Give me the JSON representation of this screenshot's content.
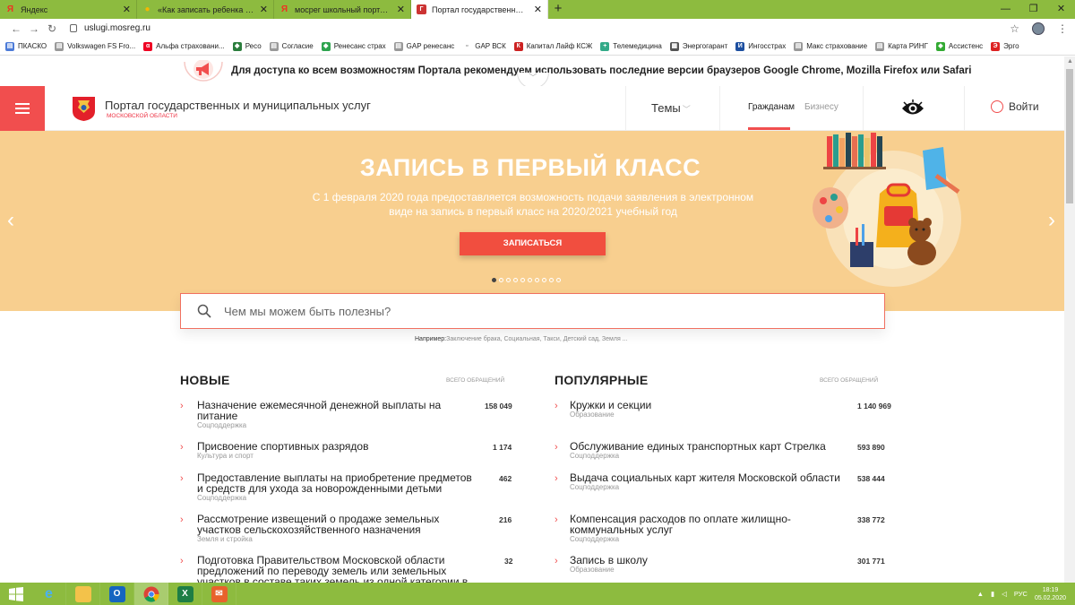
{
  "browser": {
    "tabs": [
      {
        "title": "Яндекс",
        "icon": "yandex-icon",
        "active": false
      },
      {
        "title": "«Как записать ребенка в школу»",
        "icon": "lightbulb-icon",
        "active": false
      },
      {
        "title": "мосрег школьный портал — Ян",
        "icon": "yandex-icon",
        "active": false
      },
      {
        "title": "Портал государственных и муни",
        "icon": "gosuslugi-icon",
        "active": true
      }
    ],
    "new_tab": "+",
    "url": "uslugi.mosreg.ru",
    "bookmarks": [
      "ПКАСКО",
      "Volkswagen FS Fro...",
      "Альфа страховани...",
      "Ресо",
      "Согласие",
      "Ренесанс страх",
      "GAP ренесанс",
      "GAP ВСК",
      "Капитал Лайф КСЖ",
      "Телемедицина",
      "Энергогарант",
      "Ингосстрах",
      "Макс страхование",
      "Карта РИНГ",
      "Ассистенс",
      "Эрго"
    ]
  },
  "notice": {
    "text": "Для доступа ко всем возможностям Портала рекомендуем использовать последние версии браузеров Google Chrome, Mozilla Firefox или Safari"
  },
  "header": {
    "brand": "Портал государственных и муниципальных услуг",
    "brand_sub": "МОСКОВСКОЙ ОБЛАСТИ",
    "themes": "Темы",
    "nav_citizens": "Гражданам",
    "nav_business": "Бизнесу",
    "login": "Войти"
  },
  "hero": {
    "title": "ЗАПИСЬ В ПЕРВЫЙ КЛАСС",
    "description": "С 1 февраля 2020 года предоставляется возможность подачи заявления в электронном виде на запись в первый класс на 2020/2021 учебный год",
    "button": "ЗАПИСАТЬСЯ",
    "slides_total": 10,
    "slide_active": 1
  },
  "search": {
    "placeholder": "Чем мы можем быть полезны?",
    "examples_label": "Например:",
    "examples": "Заключение брака, Социальная, Такси, Детский сад, Земля ..."
  },
  "new_services": {
    "title": "НОВЫЕ",
    "count_header": "ВСЕГО ОБРАЩЕНИЙ",
    "items": [
      {
        "name": "Назначение ежемесячной денежной выплаты на питание",
        "category": "Соцподдержка",
        "count": "158 049"
      },
      {
        "name": "Присвоение спортивных разрядов",
        "category": "Культура и спорт",
        "count": "1 174"
      },
      {
        "name": "Предоставление выплаты на приобретение предметов и средств для ухода за новорожденными детьми",
        "category": "Соцподдержка",
        "count": "462"
      },
      {
        "name": "Рассмотрение извещений о продаже земельных участков сельскохозяйственного назначения",
        "category": "Земля и стройка",
        "count": "216"
      },
      {
        "name": "Подготовка Правительством Московской области предложений по переводу земель или земельных участков в составе таких земель из одной категории в",
        "category": "",
        "count": "32"
      }
    ]
  },
  "popular_services": {
    "title": "ПОПУЛЯРНЫЕ",
    "count_header": "ВСЕГО ОБРАЩЕНИЙ",
    "items": [
      {
        "name": "Кружки и секции",
        "category": "Образование",
        "count": "1 140 969"
      },
      {
        "name": "Обслуживание единых транспортных карт Стрелка",
        "category": "Соцподдержка",
        "count": "593 890"
      },
      {
        "name": "Выдача социальных карт жителя Московской области",
        "category": "Соцподдержка",
        "count": "538 444"
      },
      {
        "name": "Компенсация расходов по оплате жилищно-коммунальных услуг",
        "category": "Соцподдержка",
        "count": "338 772"
      },
      {
        "name": "Запись в школу",
        "category": "Образование",
        "count": "301 771"
      }
    ]
  },
  "taskbar": {
    "lang": "РУС",
    "time": "18:19",
    "date": "05.02.2020"
  },
  "colors": {
    "accent": "#f14e4e",
    "hero_bg": "#f8cf8f",
    "chrome_green": "#8dbb3f"
  }
}
